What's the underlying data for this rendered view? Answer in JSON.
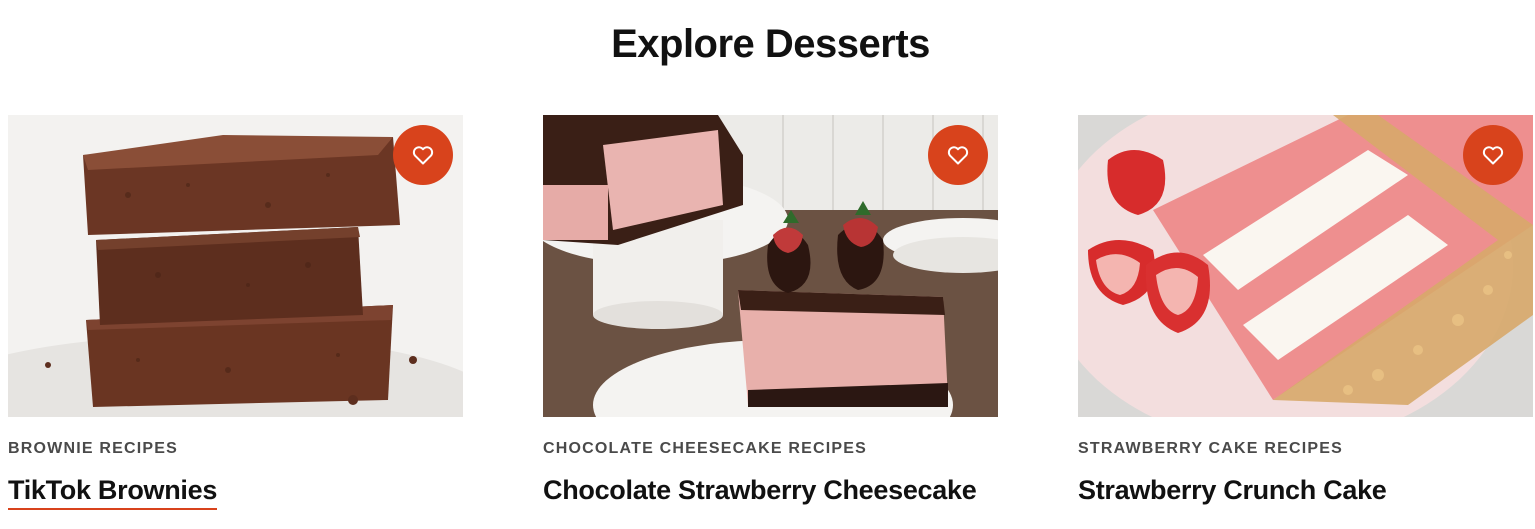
{
  "section": {
    "title": "Explore Desserts"
  },
  "theme": {
    "accent": "#d8431c",
    "text": "#111111",
    "tag_text": "#4a4a4a"
  },
  "cards": [
    {
      "tag": "BROWNIE RECIPES",
      "title": "TikTok Brownies",
      "image": "brownies-photo",
      "save_icon": "heart-icon"
    },
    {
      "tag": "CHOCOLATE CHEESECAKE RECIPES",
      "title": "Chocolate Strawberry Cheesecake",
      "image": "cheesecake-photo",
      "save_icon": "heart-icon"
    },
    {
      "tag": "STRAWBERRY CAKE RECIPES",
      "title": "Strawberry Crunch Cake",
      "image": "strawberry-cake-photo",
      "save_icon": "heart-icon"
    }
  ]
}
